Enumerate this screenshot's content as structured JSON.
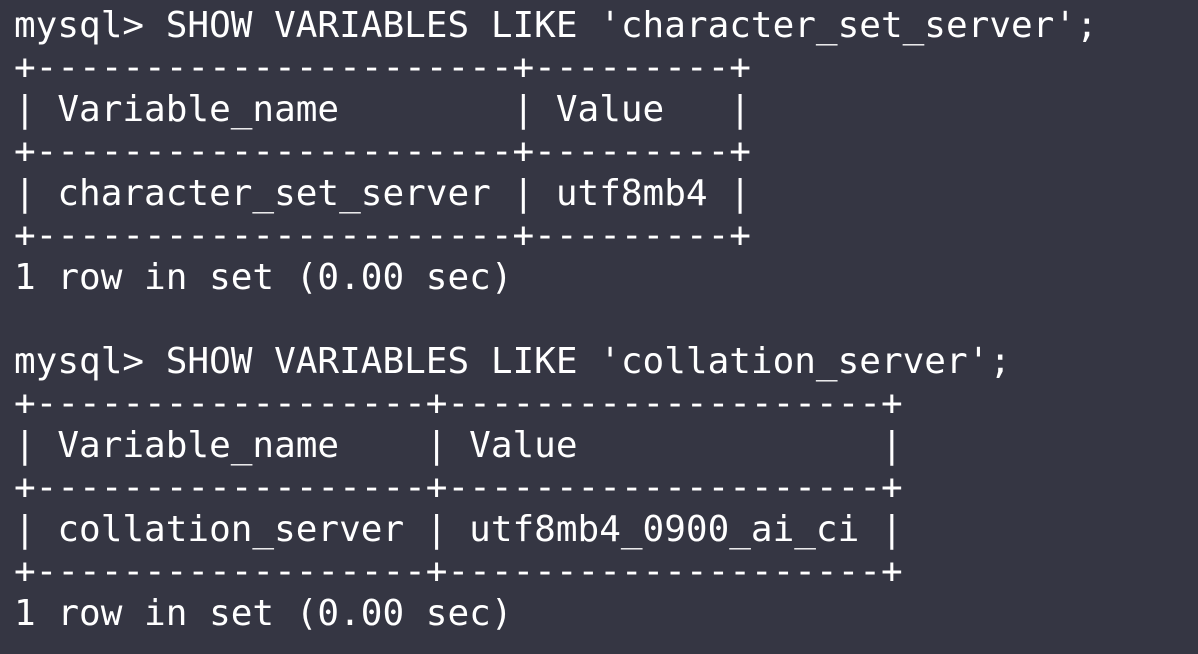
{
  "terminal": {
    "block1": {
      "command": "mysql> SHOW VARIABLES LIKE 'character_set_server';",
      "border": "+----------------------+---------+",
      "header": "| Variable_name        | Value   |",
      "row": "| character_set_server | utf8mb4 |",
      "status": "1 row in set (0.00 sec)"
    },
    "block2": {
      "command": "mysql> SHOW VARIABLES LIKE 'collation_server';",
      "border": "+------------------+--------------------+",
      "header": "| Variable_name    | Value              |",
      "row": "| collation_server | utf8mb4_0900_ai_ci |",
      "status": "1 row in set (0.00 sec)"
    },
    "colors": {
      "background": "#353643",
      "text": "#ffffff"
    }
  }
}
